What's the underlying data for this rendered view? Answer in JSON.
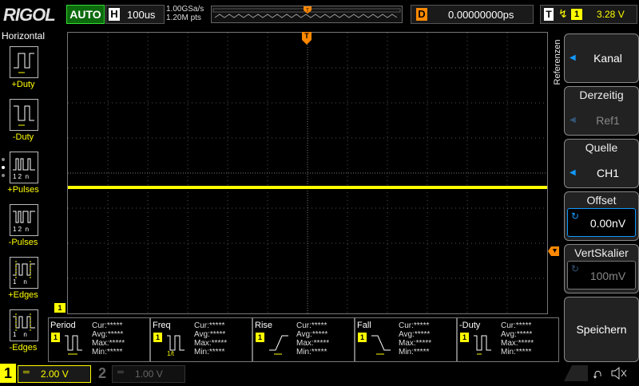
{
  "brand": "RIGOL",
  "mode": "AUTO",
  "timebase": {
    "label": "H",
    "value": "100us"
  },
  "acq": {
    "rate": "1.00GSa/s",
    "points": "1.20M pts"
  },
  "delay": {
    "label": "D",
    "value": "0.00000000ps"
  },
  "trigger": {
    "label": "T",
    "channel": "1",
    "level": "3.28 V"
  },
  "left_panel": {
    "title": "Horizontal",
    "items": [
      {
        "label": "+Duty",
        "icon": "pos-duty-icon"
      },
      {
        "label": "-Duty",
        "icon": "neg-duty-icon"
      },
      {
        "label": "+Pulses",
        "icon": "pos-pulses-icon"
      },
      {
        "label": "-Pulses",
        "icon": "neg-pulses-icon"
      },
      {
        "label": "+Edges",
        "icon": "pos-edges-icon"
      },
      {
        "label": "-Edges",
        "icon": "neg-edges-icon"
      }
    ],
    "icon_subtext": [
      "1 2  n",
      "1 2  n",
      "1    n",
      "1    n"
    ]
  },
  "grid_marker": "T",
  "ch_marker": "1",
  "right_menu": {
    "tab": "Referenzen",
    "items": [
      {
        "title": "",
        "value": "Kanal"
      },
      {
        "title": "Derzeitig",
        "value": "Ref1"
      },
      {
        "title": "Quelle",
        "value": "CH1"
      },
      {
        "title": "Offset",
        "value": "0.00nV"
      },
      {
        "title": "VertSkalier",
        "value": "100mV"
      },
      {
        "title": "",
        "value": "Speichern"
      }
    ]
  },
  "measurements": [
    {
      "name": "Period",
      "ch": "1"
    },
    {
      "name": "Freq",
      "ch": "1"
    },
    {
      "name": "Rise",
      "ch": "1"
    },
    {
      "name": "Fall",
      "ch": "1"
    },
    {
      "name": "-Duty",
      "ch": "1"
    }
  ],
  "stat_labels": {
    "cur": "Cur:*****",
    "avg": "Avg:*****",
    "max": "Max:*****",
    "min": "Min:*****"
  },
  "channels": [
    {
      "num": "1",
      "value": "2.00 V",
      "active": true
    },
    {
      "num": "2",
      "value": "1.00 V",
      "active": false
    }
  ],
  "colors": {
    "ch1": "#ffff00",
    "trigger": "#ff8800",
    "grid": "#555555",
    "menu_accent": "#1199ff"
  }
}
